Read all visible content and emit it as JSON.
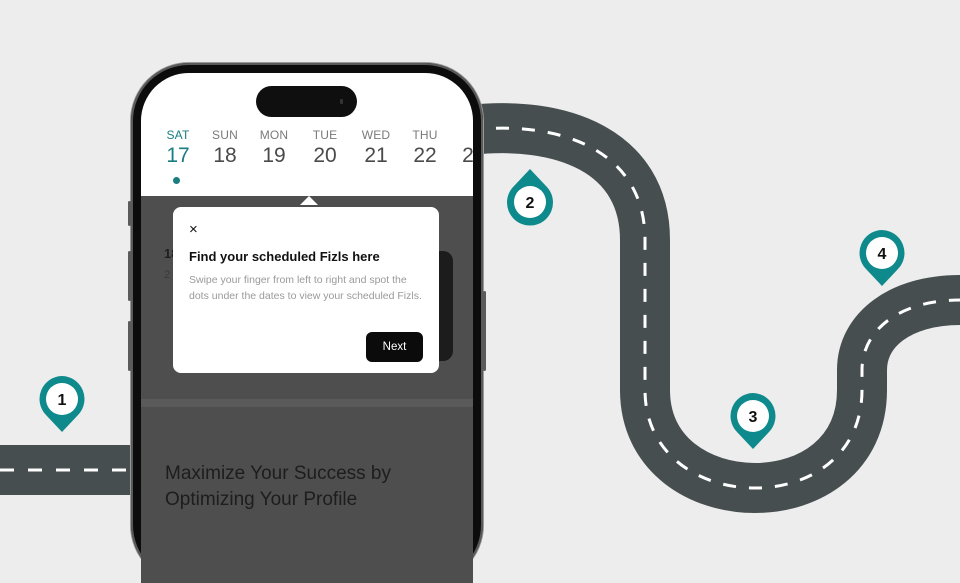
{
  "colors": {
    "background": "#ededed",
    "road": "#464e4f",
    "road_marking": "#ffffff",
    "accent_teal": "#1a7d80",
    "pin_teal": "#0f8a8c"
  },
  "calendar": {
    "days": [
      {
        "name": "SAT",
        "date": "17",
        "active": true,
        "has_dot": true
      },
      {
        "name": "SUN",
        "date": "18",
        "active": false,
        "has_dot": false
      },
      {
        "name": "MON",
        "date": "19",
        "active": false,
        "has_dot": false
      },
      {
        "name": "TUE",
        "date": "20",
        "active": false,
        "has_dot": false
      },
      {
        "name": "WED",
        "date": "21",
        "active": false,
        "has_dot": false
      },
      {
        "name": "THU",
        "date": "22",
        "active": false,
        "has_dot": false
      },
      {
        "name": "",
        "date": "2",
        "active": false,
        "has_dot": false
      }
    ]
  },
  "background_content": {
    "card_label_1": "18",
    "card_label_2": "2",
    "promo_title": "Maximize Your Success by Optimizing Your Profile"
  },
  "tooltip": {
    "close_icon": "close-icon",
    "close_glyph": "×",
    "title": "Find your scheduled Fizls here",
    "body": "Swipe your finger from left to right and spot the dots under the dates to view your scheduled Fizls.",
    "next_label": "Next"
  },
  "roadmap": {
    "pins": [
      {
        "label": "1",
        "direction": "down"
      },
      {
        "label": "2",
        "direction": "up"
      },
      {
        "label": "3",
        "direction": "down"
      },
      {
        "label": "4",
        "direction": "down"
      }
    ]
  }
}
